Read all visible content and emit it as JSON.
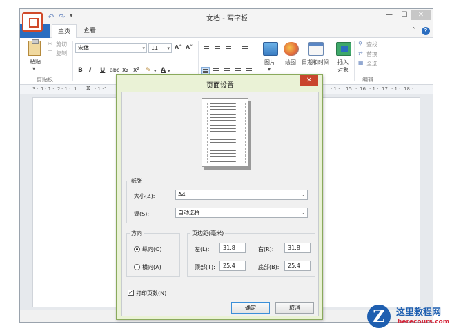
{
  "window": {
    "title": "文档 - 写字板",
    "controls": {
      "minimize": "—",
      "maximize": "☐",
      "close": "✕"
    }
  },
  "quick_access": {
    "undo": "↶",
    "redo": "↷",
    "customize": "▾"
  },
  "tabs": {
    "home": "主页",
    "view": "查看"
  },
  "ribbon": {
    "clipboard": {
      "paste": "粘贴",
      "cut": "剪切",
      "copy": "复制",
      "group_label": "剪贴板"
    },
    "font": {
      "family": "宋体",
      "size": "11",
      "grow": "A˄",
      "shrink": "A˅",
      "bold": "B",
      "italic": "I",
      "underline": "U",
      "strike": "abc",
      "subscript": "x₂",
      "superscript": "x²",
      "color": "A"
    },
    "insert": {
      "picture": "图片",
      "paint": "绘图",
      "datetime": "日期和时间",
      "object_line1": "插入",
      "object_line2": "对象"
    },
    "editing": {
      "find": "查找",
      "replace": "替换",
      "select_all": "全选",
      "group_label": "编辑"
    }
  },
  "ruler_left": [
    "3",
    "1",
    "2",
    "1",
    "1",
    "1",
    "1"
  ],
  "ruler_right": [
    "15",
    "16",
    "17",
    "18"
  ],
  "dialog": {
    "title": "页面设置",
    "close": "✕",
    "paper": {
      "legend": "纸张",
      "size_label": "大小(Z):",
      "size_value": "A4",
      "source_label": "源(S):",
      "source_value": "自动选择"
    },
    "orientation": {
      "legend": "方向",
      "portrait": "纵向(O)",
      "landscape": "横向(A)",
      "selected": "portrait"
    },
    "margins": {
      "legend": "页边距(毫米)",
      "left_label": "左(L):",
      "left_value": "31.8",
      "right_label": "右(R):",
      "right_value": "31.8",
      "top_label": "顶部(T):",
      "top_value": "25.4",
      "bottom_label": "底部(B):",
      "bottom_value": "25.4"
    },
    "print_page_numbers": {
      "label": "打印页数(N)",
      "checked": true
    },
    "ok": "确定",
    "cancel": "取消"
  },
  "watermark": {
    "logo_letter": "Z",
    "name": "这里教程网",
    "url": "herecours.com"
  }
}
